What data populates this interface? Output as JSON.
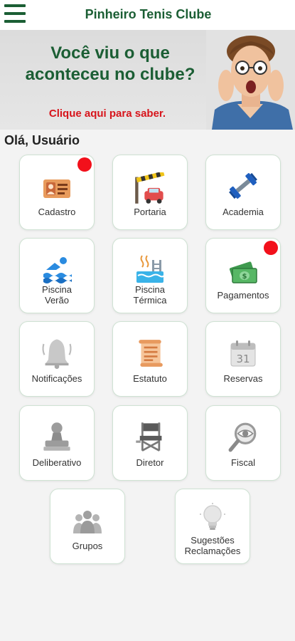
{
  "header": {
    "title": "Pinheiro Tenis Clube"
  },
  "banner": {
    "headline_line1": "Você viu o que",
    "headline_line2": "aconteceu no clube?",
    "cta": "Clique aqui para saber."
  },
  "greeting": "Olá, Usuário",
  "tiles": [
    {
      "line1": "Cadastro",
      "line2": "",
      "icon": "id-card-icon",
      "badge": true
    },
    {
      "line1": "Portaria",
      "line2": "",
      "icon": "gate-car-icon",
      "badge": false
    },
    {
      "line1": "Academia",
      "line2": "",
      "icon": "dumbbell-icon",
      "badge": false
    },
    {
      "line1": "Piscina",
      "line2": "Verão",
      "icon": "swimmer-icon",
      "badge": false
    },
    {
      "line1": "Piscina",
      "line2": "Térmica",
      "icon": "pool-icon",
      "badge": false
    },
    {
      "line1": "Pagamentos",
      "line2": "",
      "icon": "money-icon",
      "badge": true
    },
    {
      "line1": "Notificações",
      "line2": "",
      "icon": "bell-icon",
      "badge": false
    },
    {
      "line1": "Estatuto",
      "line2": "",
      "icon": "scroll-icon",
      "badge": false
    },
    {
      "line1": "Reservas",
      "line2": "",
      "icon": "calendar-icon",
      "badge": false
    },
    {
      "line1": "Deliberativo",
      "line2": "",
      "icon": "stamp-icon",
      "badge": false
    },
    {
      "line1": "Diretor",
      "line2": "",
      "icon": "director-chair-icon",
      "badge": false
    },
    {
      "line1": "Fiscal",
      "line2": "",
      "icon": "magnifier-eye-icon",
      "badge": false
    },
    {
      "line1": "Grupos",
      "line2": "",
      "icon": "group-icon",
      "badge": false
    },
    {
      "line1": "Sugestões",
      "line2": "Reclamações",
      "icon": "lightbulb-icon",
      "badge": false
    }
  ],
  "calendar_day": "31",
  "colors": {
    "brand_green": "#1b5e34",
    "cta_red": "#d7141b",
    "badge_red": "#f2101b"
  }
}
